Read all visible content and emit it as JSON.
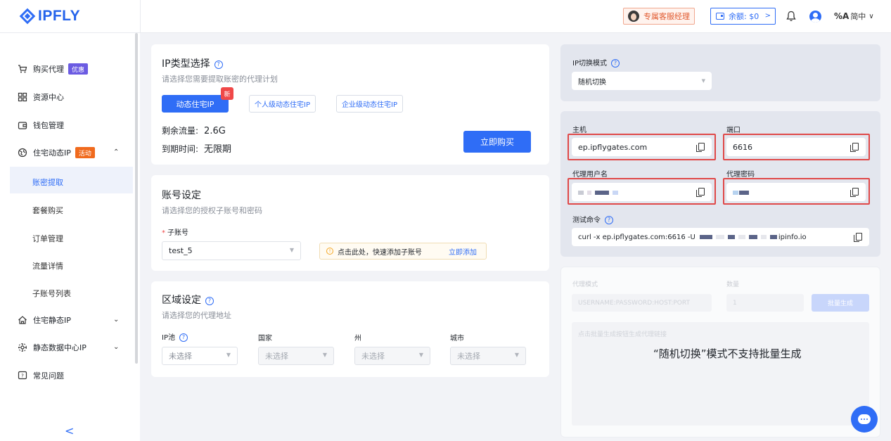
{
  "header": {
    "logo": "IPFLY",
    "service_manager": "专属客服经理",
    "balance": "余额: $0",
    "lang": "简中",
    "lang_glyph": "%A"
  },
  "sidebar": {
    "items": [
      {
        "label": "购买代理",
        "badge": "优惠"
      },
      {
        "label": "资源中心"
      },
      {
        "label": "钱包管理"
      },
      {
        "label": "住宅动态IP",
        "badge": "活动"
      },
      {
        "label": "住宅静态IP"
      },
      {
        "label": "静态数据中心IP"
      },
      {
        "label": "常见问题"
      }
    ],
    "sub_items": [
      "账密提取",
      "套餐购买",
      "订单管理",
      "流量详情",
      "子账号列表"
    ],
    "collapse": "<"
  },
  "ip_type": {
    "title": "IP类型选择",
    "subtitle": "请选择您需要提取账密的代理计划",
    "tabs": [
      "动态住宅IP",
      "个人级动态住宅IP",
      "企业级动态住宅IP"
    ],
    "new_tag": "新",
    "remaining_label": "剩余流量:",
    "remaining_value": "2.6G",
    "expiry_label": "到期时间:",
    "expiry_value": "无限期",
    "buy_button": "立即购买"
  },
  "account": {
    "title": "账号设定",
    "subtitle": "请选择您的授权子账号和密码",
    "sub_account_label": "子账号",
    "sub_account_value": "test_5",
    "tip": "点击此处，快速添加子账号",
    "tip_link": "立即添加"
  },
  "region": {
    "title": "区域设定",
    "subtitle": "请选择您的代理地址",
    "fields": [
      {
        "label": "IP池",
        "value": "未选择"
      },
      {
        "label": "国家",
        "value": "未选择"
      },
      {
        "label": "州",
        "value": "未选择"
      },
      {
        "label": "城市",
        "value": "未选择"
      }
    ]
  },
  "switch_mode": {
    "label": "IP切换模式",
    "value": "随机切换"
  },
  "credentials": {
    "host_label": "主机",
    "host_value": "ep.ipflygates.com",
    "port_label": "端口",
    "port_value": "6616",
    "user_label": "代理用户名",
    "pass_label": "代理密码",
    "test_label": "测试命令",
    "test_prefix": "curl -x ep.ipflygates.com:6616 -U",
    "test_suffix": "ipinfo.io"
  },
  "batch": {
    "mode_label": "代理模式",
    "mode_value": "USERNAME:PASSWORD:HOST:PORT",
    "count_label": "数量",
    "count_value": "1",
    "generate": "批量生成",
    "placeholder": "点击批量生成按钮生成代理链接",
    "message": "“随机切换”模式不支持批量生成"
  },
  "colors": {
    "accent": "#2f6df6",
    "highlight": "#e04848"
  }
}
